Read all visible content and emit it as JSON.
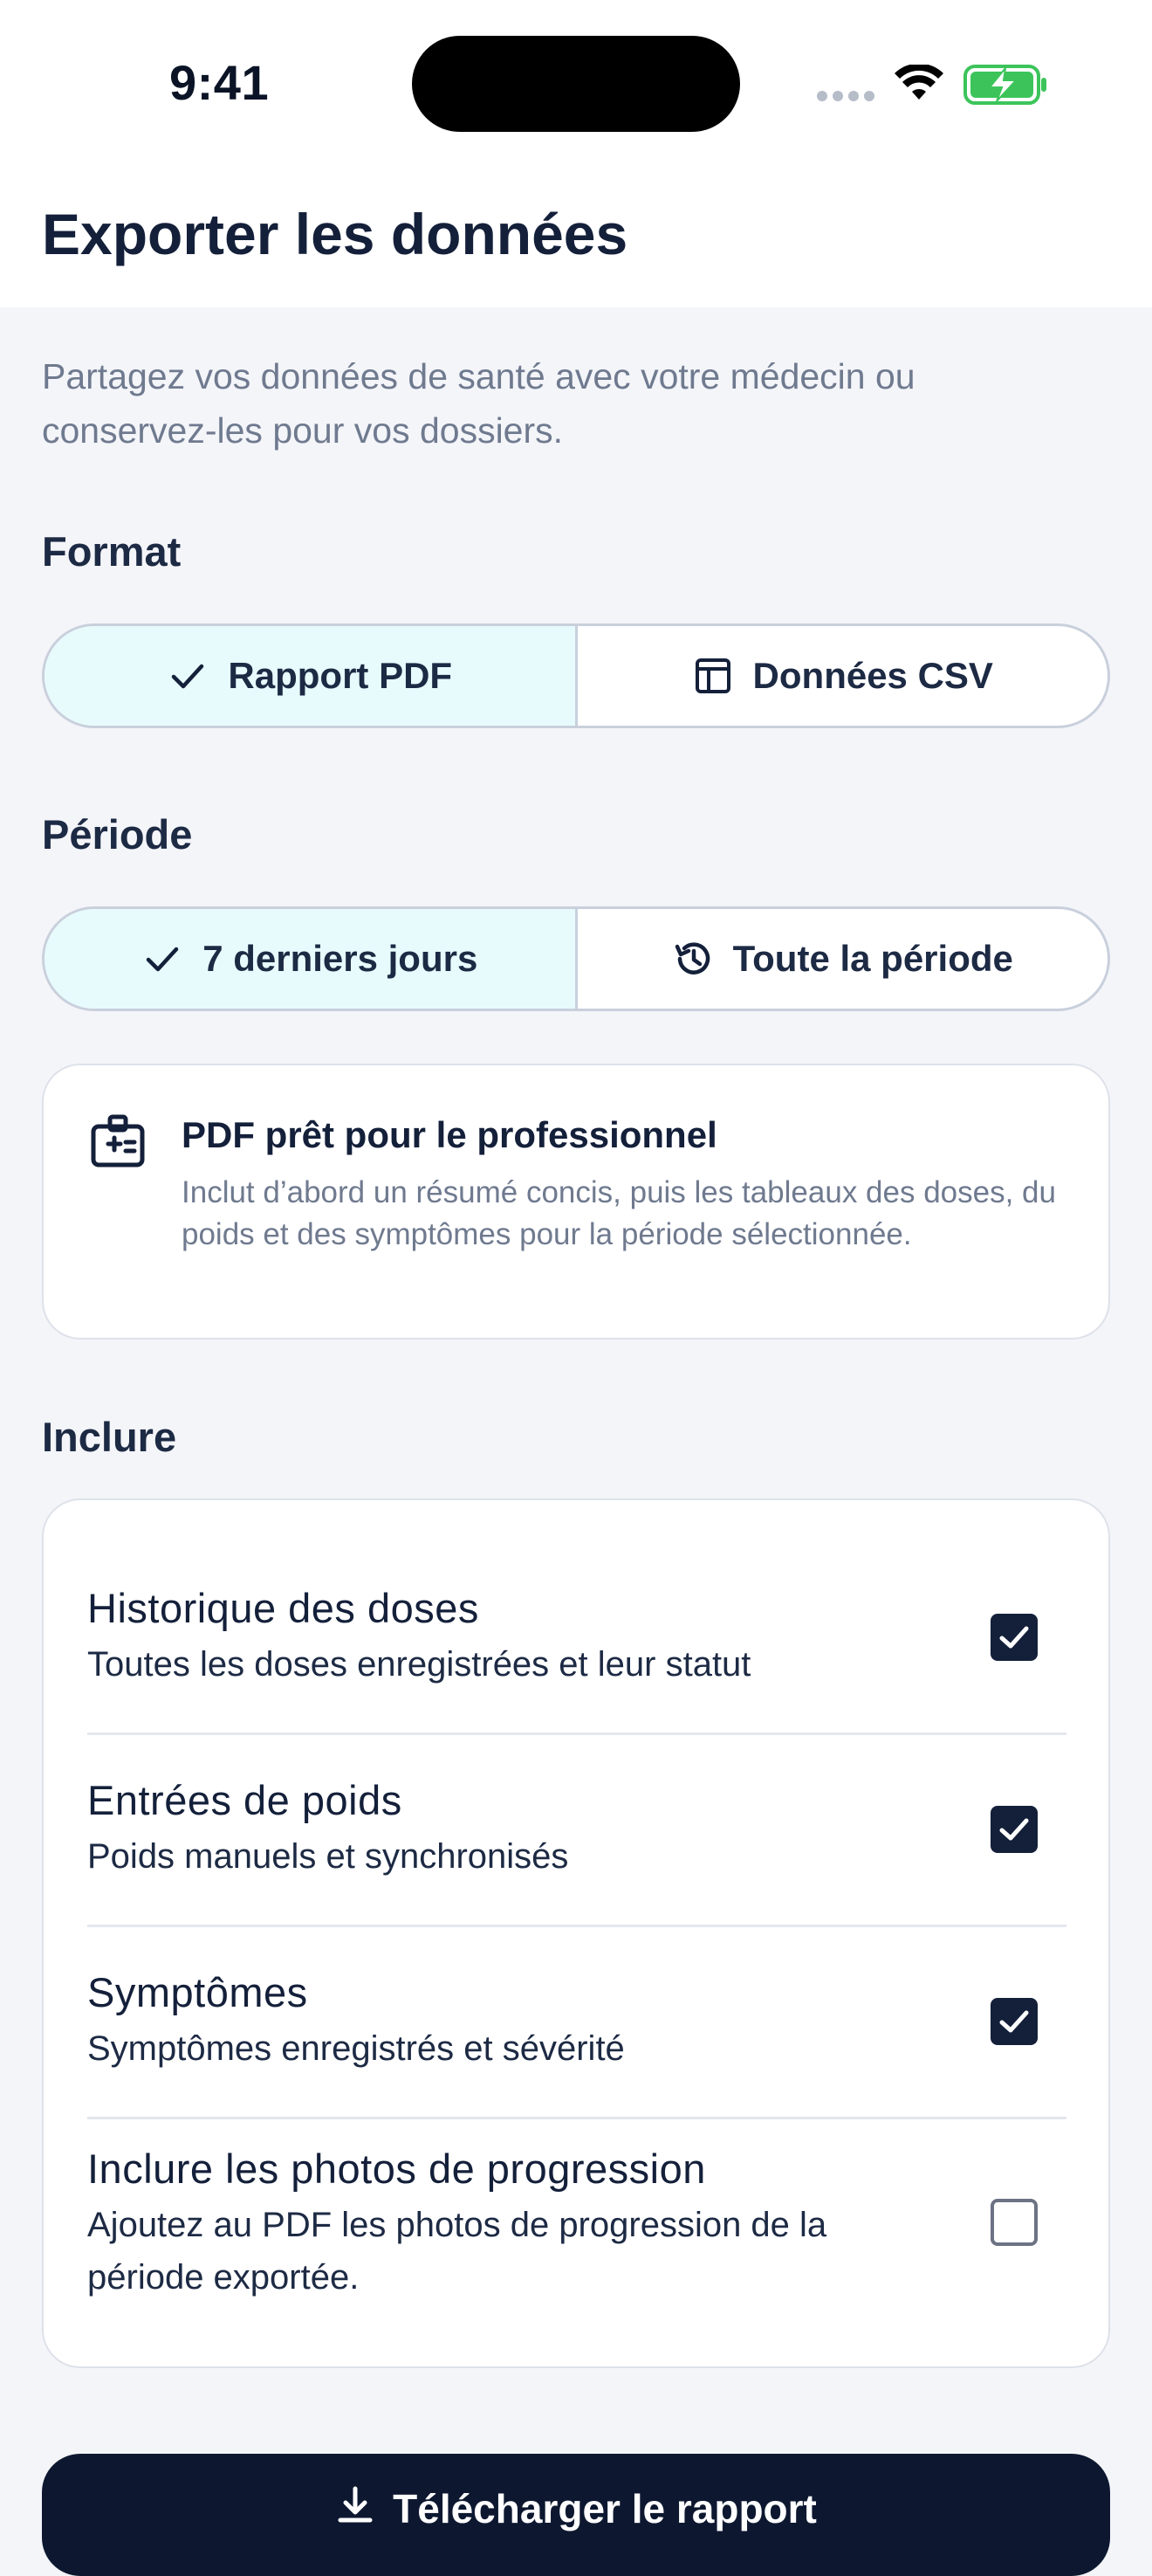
{
  "status_bar": {
    "time": "9:41",
    "battery_color": "#3cc45a",
    "icons": [
      "cellular-signal-icon",
      "wifi-icon",
      "battery-charging-icon"
    ]
  },
  "header": {
    "title": "Exporter les données"
  },
  "intro": "Partagez vos données de santé avec votre médecin ou conservez-les pour vos dossiers.",
  "format": {
    "label": "Format",
    "options": [
      {
        "label": "Rapport PDF",
        "icon": "check-icon",
        "selected": true
      },
      {
        "label": "Données CSV",
        "icon": "table-icon",
        "selected": false
      }
    ]
  },
  "period": {
    "label": "Période",
    "options": [
      {
        "label": "7 derniers jours",
        "icon": "check-icon",
        "selected": true
      },
      {
        "label": "Toute la période",
        "icon": "history-icon",
        "selected": false
      }
    ]
  },
  "info_card": {
    "icon": "medical-badge-icon",
    "title": "PDF prêt pour le professionnel",
    "description": "Inclut d’abord un résumé concis, puis les tableaux des doses, du poids et des symptômes pour la période sélectionnée."
  },
  "include": {
    "label": "Inclure",
    "items": [
      {
        "title": "Historique des doses",
        "subtitle": "Toutes les doses enregistrées et leur statut",
        "checked": true
      },
      {
        "title": "Entrées de poids",
        "subtitle": "Poids manuels et synchronisés",
        "checked": true
      },
      {
        "title": "Symptômes",
        "subtitle": "Symptômes enregistrés et sévérité",
        "checked": true
      },
      {
        "title": "Inclure les photos de progression",
        "subtitle": "Ajoutez au PDF les photos de progression de la période exportée.",
        "checked": false
      }
    ]
  },
  "cta": {
    "label": "Télécharger le rapport",
    "icon": "download-icon"
  },
  "colors": {
    "accent_selected_bg": "#e7fbfd",
    "primary_dark": "#14203a",
    "muted_text": "#6f7a8f"
  }
}
